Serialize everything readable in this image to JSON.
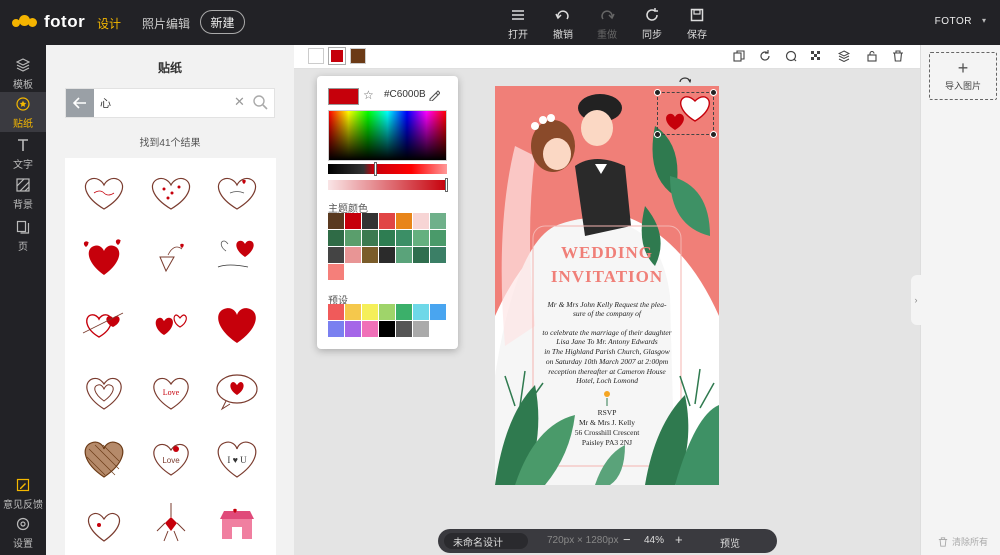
{
  "topbar": {
    "logo": "fotor",
    "nav_design": "设计",
    "nav_photo": "照片编辑",
    "new_label": "新建",
    "tools": [
      {
        "label": "打开",
        "icon": "menu-icon"
      },
      {
        "label": "撤销",
        "icon": "undo-icon"
      },
      {
        "label": "重做",
        "icon": "redo-icon"
      },
      {
        "label": "同步",
        "icon": "sync-icon"
      },
      {
        "label": "保存",
        "icon": "save-icon"
      }
    ],
    "brand": "FOTOR"
  },
  "rail": {
    "items": [
      {
        "label": "模板",
        "icon": "layers-icon"
      },
      {
        "label": "贴纸",
        "icon": "sticker-icon"
      },
      {
        "label": "文字",
        "icon": "text-icon"
      },
      {
        "label": "背景",
        "icon": "background-icon"
      },
      {
        "label": "页",
        "icon": "pages-icon"
      }
    ],
    "feedback": "意见反馈",
    "settings": "设置"
  },
  "sticker_panel": {
    "title": "贴纸",
    "search_value": "心",
    "result_count": "找到41个结果"
  },
  "color_picker": {
    "hex": "#C6000B",
    "current_color": "#C6000B",
    "theme_label": "主题颜色",
    "preset_label": "预设",
    "theme_colors": [
      "#5a3a20",
      "#c6000b",
      "#333333",
      "#e14545",
      "#e8851a",
      "#f7d5d5",
      "#6fb08a",
      "#2f6b46",
      "#5a9e6c",
      "#3c7a50",
      "#2e7d52",
      "#3b8f66",
      "#65b07f",
      "#4a9a6a",
      "#444444",
      "#e89595",
      "#7a5c2a",
      "#2b2b2b",
      "#5aa37a",
      "#2f6e4e",
      "#3b7f66",
      "#f57f7a"
    ],
    "preset_colors": [
      "#f05a5a",
      "#f5c84c",
      "#f5ef59",
      "#9fd46a",
      "#3bb06a",
      "#6ed8e8",
      "#49a5f0",
      "#7a80f0",
      "#a566e8",
      "#f070b8",
      "#000000",
      "#555555",
      "#aaaaaa"
    ]
  },
  "context_bar": {
    "swatches": [
      "#ffffff",
      "#c6000b",
      "#6b3a16"
    ]
  },
  "card": {
    "title_line1": "WEDDING",
    "title_line2": "INVITATION",
    "line1": "Mr & Mrs John Kelly  Request the plea-",
    "line2": "sure of the company of",
    "line3": "to celebrate the marriage of their daughter",
    "line4": "Lisa Jane To  Mr. Antony Edwards",
    "line5": "in The Highland Parish Church, Glasgow",
    "line6": "on Saturday 10th March 2007  at 2:00pm",
    "line7": "reception thereafter at Cameron House",
    "line8": "Hotel,  Loch Lomond",
    "rsvp1": "RSVP",
    "rsvp2": "Mr & Mrs J. Kelly",
    "rsvp3": "56 Crosshill Crescent",
    "rsvp4": "Paisley PA3 2NJ"
  },
  "bottombar": {
    "doc_name": "未命名设计",
    "size": "720px × 1280px",
    "zoom": "44%",
    "preview": "预览",
    "minus": "−",
    "plus": "+"
  },
  "right_panel": {
    "import_label": "导入图片",
    "clear_all": "清除所有"
  }
}
